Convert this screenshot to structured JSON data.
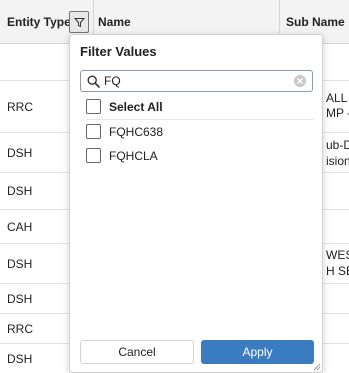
{
  "header": {
    "entity_type_label": "Entity Type",
    "name_label": "Name",
    "sub_name_label": "Sub Name"
  },
  "rows": [
    {
      "entity_type": "",
      "right_text": [
        "",
        ""
      ]
    },
    {
      "entity_type": "RRC",
      "right_text": [
        "ALL N",
        "MP -"
      ]
    },
    {
      "entity_type": "DSH",
      "right_text": [
        "ub-Di",
        "ision"
      ]
    },
    {
      "entity_type": "DSH",
      "right_text": [
        "",
        ""
      ]
    },
    {
      "entity_type": "CAH",
      "right_text": [
        "",
        ""
      ]
    },
    {
      "entity_type": "DSH",
      "right_text": [
        "WEST",
        "H SER"
      ]
    },
    {
      "entity_type": "DSH",
      "right_text": [
        "",
        ""
      ]
    },
    {
      "entity_type": "RRC",
      "right_text": [
        "",
        ""
      ]
    },
    {
      "entity_type": "DSH",
      "right_text": [
        "",
        ""
      ]
    }
  ],
  "filter_popup": {
    "title": "Filter Values",
    "search": {
      "value": "FQ",
      "placeholder": ""
    },
    "select_all_label": "Select All",
    "options": [
      {
        "label": "FQHC638",
        "checked": false
      },
      {
        "label": "FQHCLA",
        "checked": false
      }
    ],
    "cancel_label": "Cancel",
    "apply_label": "Apply"
  },
  "colors": {
    "apply_button": "#3b7bc0",
    "header_bg": "#f3f3f3"
  }
}
